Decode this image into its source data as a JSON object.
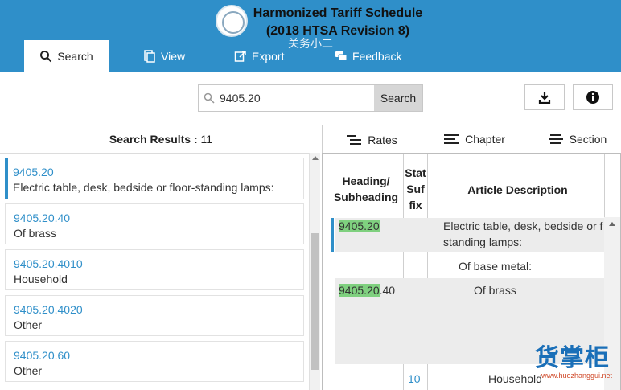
{
  "header": {
    "title_line1": "Harmonized Tariff Schedule",
    "title_line2": "(2018 HTSA Revision 8)",
    "watermark": "关务小二"
  },
  "nav": {
    "tabs": [
      {
        "label": "Search",
        "icon": "search-icon",
        "active": true
      },
      {
        "label": "View",
        "icon": "view-icon"
      },
      {
        "label": "Export",
        "icon": "export-icon"
      },
      {
        "label": "Feedback",
        "icon": "feedback-icon"
      }
    ]
  },
  "search": {
    "value": "9405.20",
    "button_label": "Search"
  },
  "results": {
    "label": "Search Results :",
    "count": "11",
    "items": [
      {
        "code": "9405.20",
        "desc": "Electric table, desk, bedside or floor-standing lamps:"
      },
      {
        "code": "9405.20.40",
        "desc": "Of brass"
      },
      {
        "code": "9405.20.4010",
        "desc": "Household"
      },
      {
        "code": "9405.20.4020",
        "desc": "Other"
      },
      {
        "code": "9405.20.60",
        "desc": "Other"
      }
    ]
  },
  "detail_tabs": [
    {
      "label": "Rates",
      "icon": "rates-icon",
      "active": true
    },
    {
      "label": "Chapter",
      "icon": "chapter-icon"
    },
    {
      "label": "Section",
      "icon": "section-icon"
    }
  ],
  "table": {
    "headers": {
      "heading": "Heading/ Subheading",
      "stat_suffix": "Stat Suf fix",
      "description": "Article Description"
    },
    "rows": [
      {
        "heading_hl": "9405.20",
        "heading_rest": "",
        "suffix": "",
        "desc": "Electric table, desk, bedside or f",
        "desc2": "standing lamps:"
      },
      {
        "heading_hl": "",
        "heading_rest": "",
        "suffix": "",
        "desc": "Of base metal:"
      },
      {
        "heading_hl": "9405.20",
        "heading_rest": ".40",
        "suffix": "",
        "desc": "Of brass"
      },
      {
        "heading_hl": "",
        "heading_rest": "",
        "suffix": "10",
        "desc": "Household"
      }
    ]
  },
  "watermark_logo": {
    "text": "货掌柜",
    "url": "www.huozhanggui.net"
  },
  "colors": {
    "brand": "#2f8fc9",
    "highlight": "#7fd07f"
  }
}
